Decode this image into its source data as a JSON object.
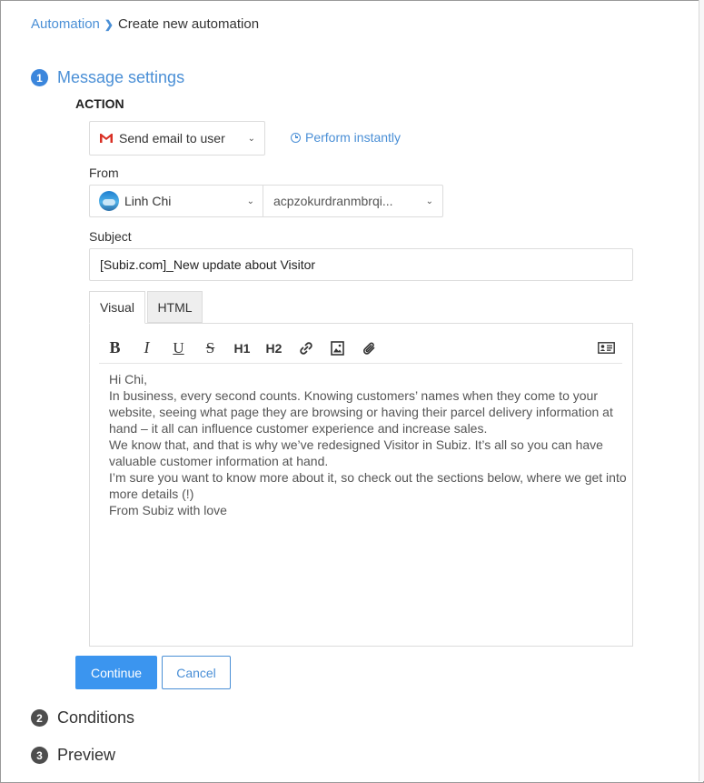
{
  "breadcrumb": {
    "parent": "Automation",
    "separator": "❯",
    "current": "Create new automation"
  },
  "steps": [
    {
      "number": "1",
      "title": "Message settings"
    },
    {
      "number": "2",
      "title": "Conditions"
    },
    {
      "number": "3",
      "title": "Preview"
    }
  ],
  "action": {
    "heading": "ACTION",
    "select_value": "Send email to user",
    "perform_label": "Perform instantly"
  },
  "from": {
    "label": "From",
    "sender_name": "Linh Chi",
    "sender_email": "acpzokurdranmbrqi..."
  },
  "subject": {
    "label": "Subject",
    "value": "[Subiz.com]_New update about Visitor"
  },
  "editor": {
    "tabs": [
      "Visual",
      "HTML"
    ],
    "toolbar": {
      "bold": "B",
      "italic": "I",
      "underline": "U",
      "strike": "S",
      "h1": "H1",
      "h2": "H2"
    },
    "body_lines": [
      "Hi Chi,",
      "In business, every second counts. Knowing customers’ names when they come to your website, seeing what page they are browsing or having their parcel delivery information at hand – it all can influence customer experience and increase sales.",
      "We know that, and that is why we’ve redesigned Visitor in Subiz. It’s all so you can have valuable customer information at hand.",
      "I’m sure you want to know more about it, so check out the sections below, where we get into more details (!)",
      "From Subiz with love"
    ]
  },
  "buttons": {
    "continue": "Continue",
    "cancel": "Cancel"
  },
  "colors": {
    "accent": "#3b86dc",
    "link": "#4a8fd6",
    "primary_button": "#3b95ef"
  }
}
